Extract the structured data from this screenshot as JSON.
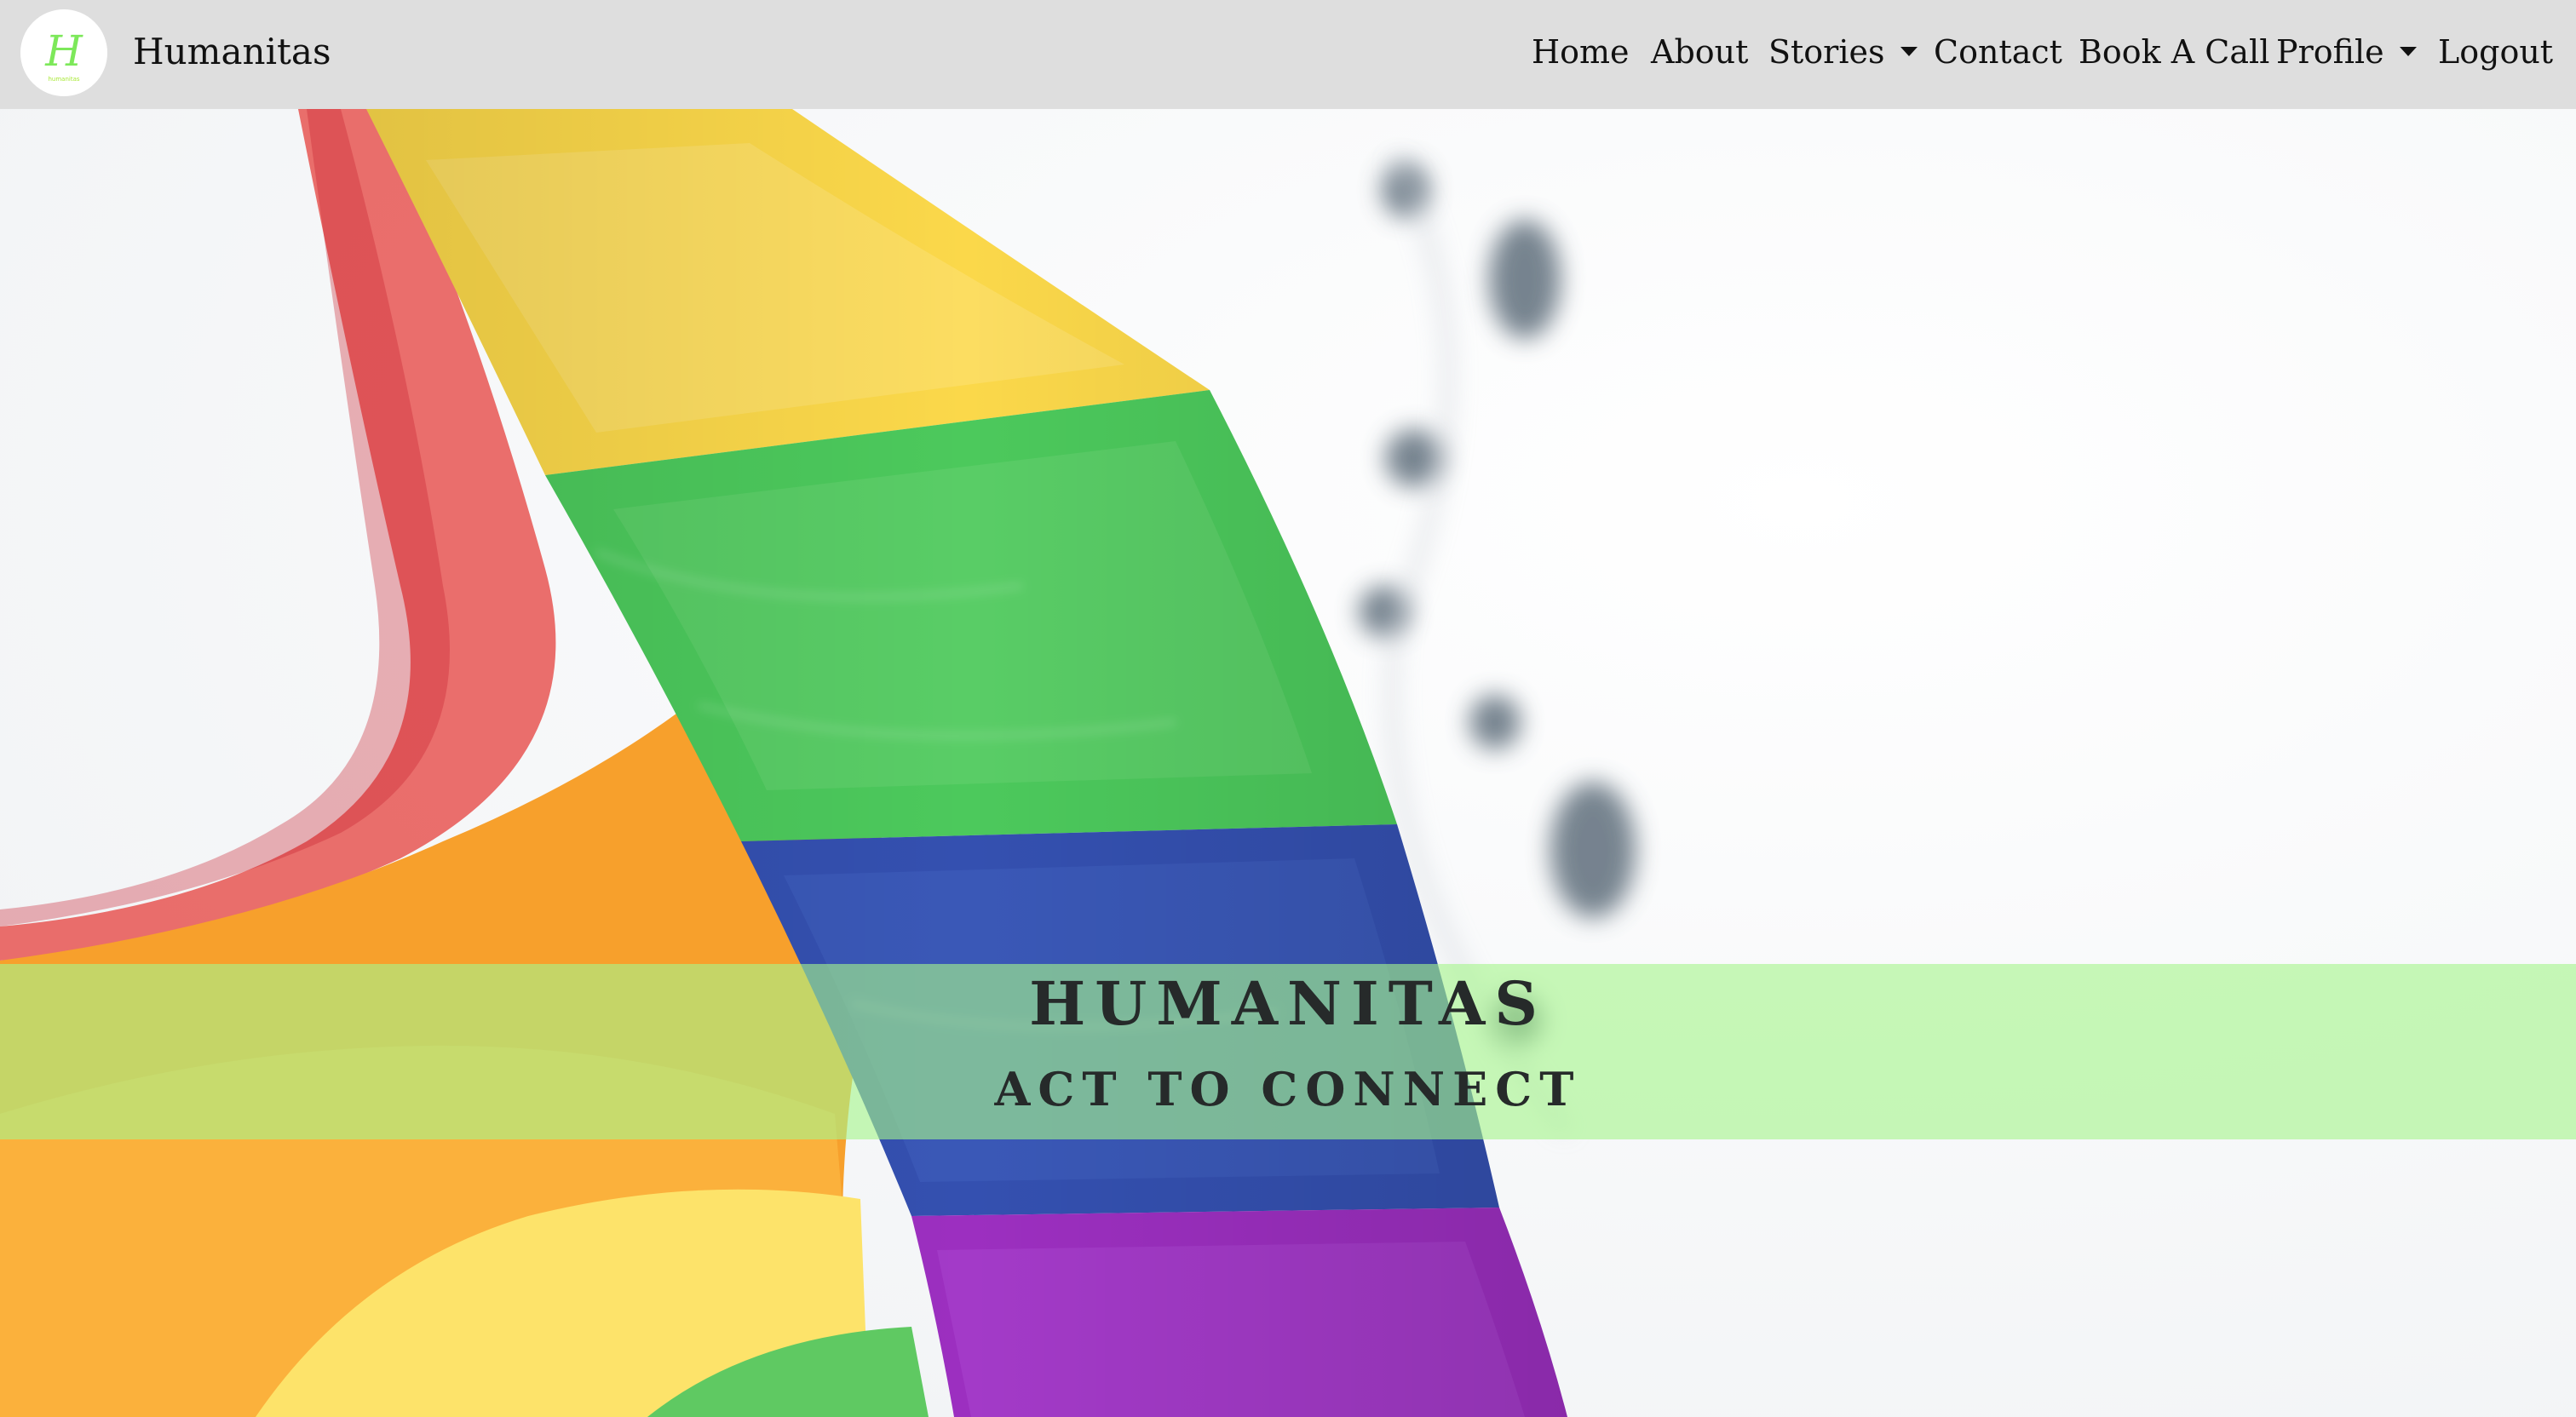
{
  "brand": {
    "logo_letter": "H",
    "logo_caption": "humanitas",
    "name": "Humanitas"
  },
  "nav": {
    "home": "Home",
    "about": "About",
    "stories": "Stories",
    "contact": "Contact",
    "book_a_call": "Book A Call",
    "profile": "Profile",
    "logout": "Logout"
  },
  "hero": {
    "title": "HUMANITAS",
    "subtitle": "ACT TO CONNECT",
    "banner_color": "#a6f68c",
    "flag_colors": [
      "#e53935",
      "#f7a02c",
      "#fbd84a",
      "#4cc95c",
      "#3450b0",
      "#9c2fc0"
    ]
  },
  "colors": {
    "navbar_background": "#dedede",
    "logo_accent": "#7de85a"
  }
}
